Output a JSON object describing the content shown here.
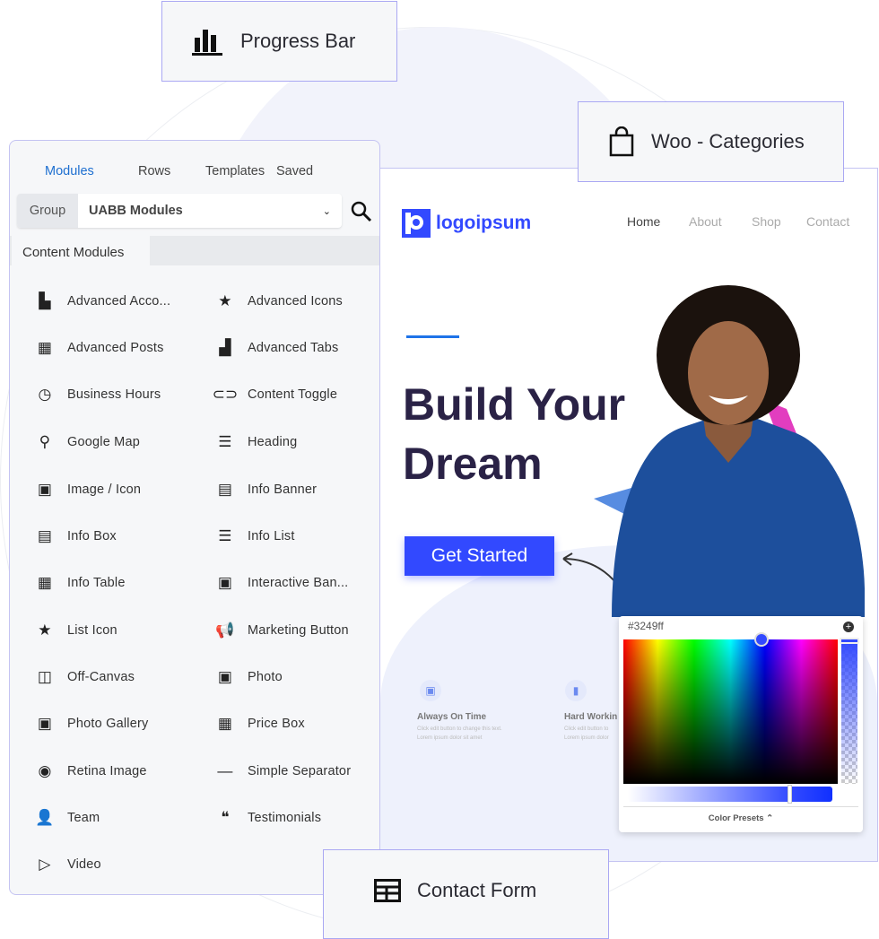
{
  "cards": {
    "progress_bar": "Progress Bar",
    "woo_categories": "Woo - Categories",
    "contact_form": "Contact Form"
  },
  "panel": {
    "tabs": [
      "Modules",
      "Rows",
      "Templates",
      "Saved"
    ],
    "active_tab": "Modules",
    "group_label": "Group",
    "group_value": "UABB Modules",
    "section": "Content Modules",
    "modules": [
      {
        "label": "Advanced Acco...",
        "icon": "accordion-icon"
      },
      {
        "label": "Advanced Icons",
        "icon": "star-icon"
      },
      {
        "label": "Advanced Posts",
        "icon": "posts-grid-icon"
      },
      {
        "label": "Advanced Tabs",
        "icon": "tabs-icon"
      },
      {
        "label": "Business Hours",
        "icon": "clock-icon"
      },
      {
        "label": "Content Toggle",
        "icon": "toggle-icon"
      },
      {
        "label": "Google Map",
        "icon": "map-pin-icon"
      },
      {
        "label": "Heading",
        "icon": "heading-icon"
      },
      {
        "label": "Image / Icon",
        "icon": "image-icon"
      },
      {
        "label": "Info Banner",
        "icon": "banner-icon"
      },
      {
        "label": "Info Box",
        "icon": "info-box-icon"
      },
      {
        "label": "Info List",
        "icon": "list-icon"
      },
      {
        "label": "Info Table",
        "icon": "table-icon"
      },
      {
        "label": "Interactive Ban...",
        "icon": "image-icon"
      },
      {
        "label": "List Icon",
        "icon": "star-icon"
      },
      {
        "label": "Marketing Button",
        "icon": "megaphone-icon"
      },
      {
        "label": "Off-Canvas",
        "icon": "off-canvas-icon"
      },
      {
        "label": "Photo",
        "icon": "photo-icon"
      },
      {
        "label": "Photo Gallery",
        "icon": "gallery-icon"
      },
      {
        "label": "Price Box",
        "icon": "table-icon"
      },
      {
        "label": "Retina Image",
        "icon": "eye-icon"
      },
      {
        "label": "Simple Separator",
        "icon": "separator-icon"
      },
      {
        "label": "Team",
        "icon": "person-icon"
      },
      {
        "label": "Testimonials",
        "icon": "quote-icon"
      },
      {
        "label": "Video",
        "icon": "video-icon"
      }
    ]
  },
  "site": {
    "logo": "logoipsum",
    "nav": [
      "Home",
      "About",
      "Shop",
      "Contact"
    ],
    "heading_1": "Build Your",
    "heading_2": "Dream",
    "cta": "Get Started",
    "features": [
      {
        "title": "Always On Time",
        "line1": "Click edit button to change this text.",
        "line2": "Lorem ipsum dolor sit amet"
      },
      {
        "title": "Hard Workin",
        "line1": "Click edit button to",
        "line2": "Lorem ipsum dolor"
      }
    ],
    "accent": "#3249ff",
    "heading_color": "#2a2246"
  },
  "picker": {
    "hex": "#3249ff",
    "presets_label": "Color Presets",
    "opacity": 0.8
  }
}
